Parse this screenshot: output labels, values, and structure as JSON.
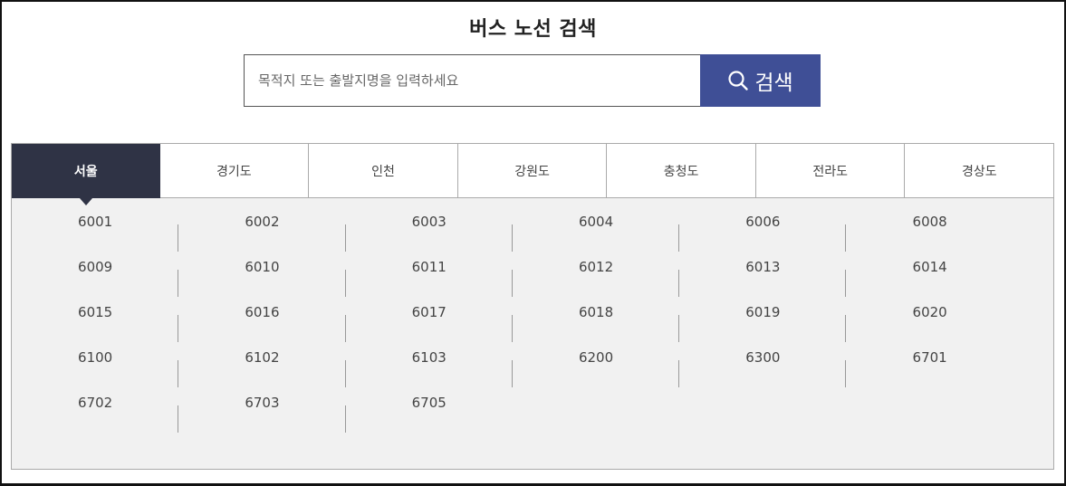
{
  "page": {
    "title": "버스 노선 검색"
  },
  "search": {
    "placeholder": "목적지 또는 출발지명을 입력하세요",
    "value": "",
    "button_label": "검색",
    "button_icon": "search-icon",
    "button_color": "#3f4f96"
  },
  "tabs": [
    {
      "label": "서울",
      "active": true
    },
    {
      "label": "경기도",
      "active": false
    },
    {
      "label": "인천",
      "active": false
    },
    {
      "label": "강원도",
      "active": false
    },
    {
      "label": "충청도",
      "active": false
    },
    {
      "label": "전라도",
      "active": false
    },
    {
      "label": "경상도",
      "active": false
    }
  ],
  "active_tab_color": "#2f3345",
  "routes": [
    "6001",
    "6002",
    "6003",
    "6004",
    "6006",
    "6008",
    "6009",
    "6010",
    "6011",
    "6012",
    "6013",
    "6014",
    "6015",
    "6016",
    "6017",
    "6018",
    "6019",
    "6020",
    "6100",
    "6102",
    "6103",
    "6200",
    "6300",
    "6701",
    "6702",
    "6703",
    "6705"
  ]
}
